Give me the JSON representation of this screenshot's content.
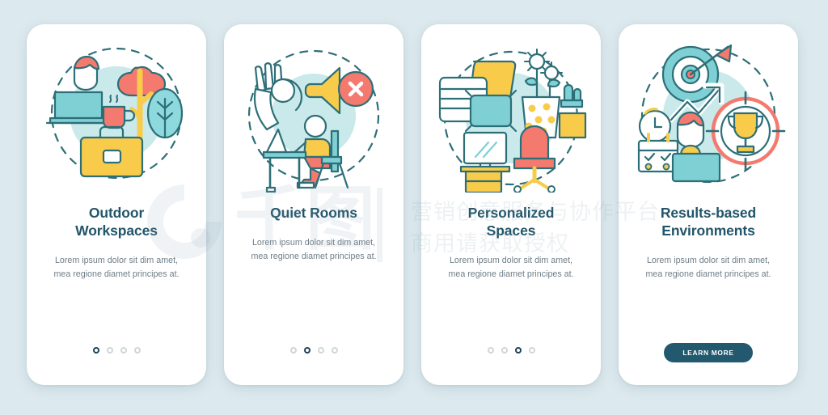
{
  "page": {
    "background_color": "#dce9ee",
    "card_background": "#ffffff"
  },
  "palette": {
    "title_color": "#23556a",
    "body_color": "#6f7e88",
    "accent_teal": "#6fcbd1",
    "accent_teal_light": "#bfe7ea",
    "accent_coral": "#f4796e",
    "accent_yellow": "#f8cc4a",
    "outline": "#2d6f78",
    "button_color": "#22596f",
    "dot_active": "#1d4456",
    "dot_inactive": "#cfd6da"
  },
  "screens": [
    {
      "illustration_name": "outdoor-workspaces-illustration",
      "title": "Outdoor\nWorkspaces",
      "title_line1": "Outdoor",
      "title_line2": "Workspaces",
      "body": "Lorem ipsum dolor sit dim amet, mea regione diamet principes at.",
      "dots": {
        "count": 4,
        "active_index": 0
      },
      "cta": null
    },
    {
      "illustration_name": "quiet-rooms-illustration",
      "title": "Quiet Rooms",
      "title_line1": "Quiet Rooms",
      "title_line2": "",
      "body": "Lorem ipsum dolor sit dim amet, mea regione diamet principes at.",
      "dots": {
        "count": 4,
        "active_index": 1
      },
      "cta": null
    },
    {
      "illustration_name": "personalized-spaces-illustration",
      "title": "Personalized\nSpaces",
      "title_line1": "Personalized",
      "title_line2": "Spaces",
      "body": "Lorem ipsum dolor sit dim amet, mea regione diamet principes at.",
      "dots": {
        "count": 4,
        "active_index": 2
      },
      "cta": null
    },
    {
      "illustration_name": "results-based-environments-illustration",
      "title": "Results-based\nEnvironments",
      "title_line1": "Results-based",
      "title_line2": "Environments",
      "body": "Lorem ipsum dolor sit dim amet, mea regione diamet principes at.",
      "dots": null,
      "cta": "LEARN MORE"
    }
  ],
  "watermark": {
    "logo_name": "qiantu-logo-watermark",
    "characters": "千图",
    "line1": "营销创意服务与协作平台",
    "line2": "商用请获取授权"
  }
}
